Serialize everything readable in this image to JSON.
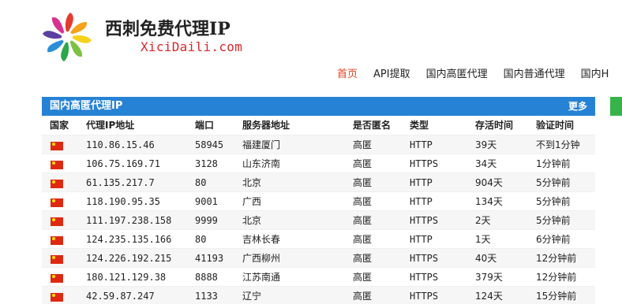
{
  "site": {
    "title": "西刺免费代理IP",
    "subtitle": "XiciDaili.com",
    "logo_icon": "colorful-swirl-logo"
  },
  "nav": {
    "items": [
      {
        "label": "首页",
        "active": true
      },
      {
        "label": "API提取",
        "active": false
      },
      {
        "label": "国内高匿代理",
        "active": false
      },
      {
        "label": "国内普通代理",
        "active": false
      },
      {
        "label": "国内H",
        "active": false
      }
    ],
    "active_color": "#e0431c"
  },
  "panel": {
    "title": "国内高匿代理IP",
    "more_label": "更多",
    "header_color": "#2682d4",
    "columns": [
      "国家",
      "代理IP地址",
      "端口",
      "服务器地址",
      "是否匿名",
      "类型",
      "存活时间",
      "验证时间"
    ],
    "rows": [
      {
        "country": "cn-flag-icon",
        "ip": "110.86.15.46",
        "port": "58945",
        "location": "福建厦门",
        "anon": "高匿",
        "type": "HTTP",
        "alive": "39天",
        "verified": "不到1分钟"
      },
      {
        "country": "cn-flag-icon",
        "ip": "106.75.169.71",
        "port": "3128",
        "location": "山东济南",
        "anon": "高匿",
        "type": "HTTPS",
        "alive": "34天",
        "verified": "1分钟前"
      },
      {
        "country": "cn-flag-icon",
        "ip": "61.135.217.7",
        "port": "80",
        "location": "北京",
        "anon": "高匿",
        "type": "HTTP",
        "alive": "904天",
        "verified": "5分钟前"
      },
      {
        "country": "cn-flag-icon",
        "ip": "118.190.95.35",
        "port": "9001",
        "location": "广西",
        "anon": "高匿",
        "type": "HTTP",
        "alive": "134天",
        "verified": "5分钟前"
      },
      {
        "country": "cn-flag-icon",
        "ip": "111.197.238.158",
        "port": "9999",
        "location": "北京",
        "anon": "高匿",
        "type": "HTTPS",
        "alive": "2天",
        "verified": "5分钟前"
      },
      {
        "country": "cn-flag-icon",
        "ip": "124.235.135.166",
        "port": "80",
        "location": "吉林长春",
        "anon": "高匿",
        "type": "HTTP",
        "alive": "1天",
        "verified": "6分钟前"
      },
      {
        "country": "cn-flag-icon",
        "ip": "124.226.192.215",
        "port": "41193",
        "location": "广西柳州",
        "anon": "高匿",
        "type": "HTTPS",
        "alive": "40天",
        "verified": "12分钟前"
      },
      {
        "country": "cn-flag-icon",
        "ip": "180.121.129.38",
        "port": "8888",
        "location": "江苏南通",
        "anon": "高匿",
        "type": "HTTPS",
        "alive": "379天",
        "verified": "12分钟前"
      },
      {
        "country": "cn-flag-icon",
        "ip": "42.59.87.247",
        "port": "1133",
        "location": "辽宁",
        "anon": "高匿",
        "type": "HTTPS",
        "alive": "124天",
        "verified": "15分钟前"
      }
    ]
  },
  "right_panel_color": "#38b34a"
}
